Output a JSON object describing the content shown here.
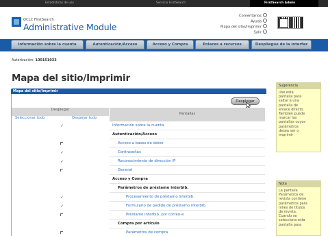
{
  "topbar": {
    "tab1": "Estadísticas de uso",
    "tab2": "Servicio FirstSearch",
    "tab3": "FirstSearch Admin"
  },
  "header": {
    "org": "OCLC FirstSearch",
    "module": "Administrative Module",
    "links": [
      "Comentarios",
      "Ayuda",
      "Mapa del sitio/Imprimir",
      "Salir"
    ]
  },
  "main_tabs": [
    "Información sobre la cuenta",
    "Autenticación/Acceso",
    "Acceso y Compra",
    "Enlaces a recursos",
    "Despliegue de la interfaz"
  ],
  "auth": {
    "label": "Autorización:",
    "value": "100151033"
  },
  "page_title": "Mapa del sitio/Imprimir",
  "panel": {
    "header": "Mapa del sitio/Imprimir",
    "button_label": "Desplegar",
    "col_desplegar": "Desplegar",
    "col_pantallas": "Pantallas",
    "select_all": "Seleccionar todo",
    "deselect_all": "Despejar todo"
  },
  "rows": [
    {
      "label": "Información sobre la cuenta",
      "style": "link",
      "indent": 0,
      "checkbox": "checked"
    },
    {
      "label": "Autenticación/Acceso",
      "style": "bold",
      "indent": 0,
      "checkbox": "none"
    },
    {
      "label": "Acceso a bases de datos",
      "style": "link",
      "indent": 1,
      "checkbox": "unchecked"
    },
    {
      "label": "Contraseñas",
      "style": "link",
      "indent": 1,
      "checkbox": "checked"
    },
    {
      "label": "Reconocimiento de dirección IP",
      "style": "link",
      "indent": 1,
      "checkbox": "checked"
    },
    {
      "label": "General",
      "style": "link",
      "indent": 1,
      "checkbox": "unchecked"
    },
    {
      "label": "Acceso y Compra",
      "style": "bold",
      "indent": 0,
      "checkbox": "none"
    },
    {
      "label": "Parámetros de préstamo interbib.",
      "style": "bold",
      "indent": 1,
      "checkbox": "none"
    },
    {
      "label": "Procesamiento de préstamo interbib.",
      "style": "link",
      "indent": 2,
      "checkbox": "checked"
    },
    {
      "label": "Formulario de pedido de préstamo interbib.",
      "style": "link",
      "indent": 2,
      "checkbox": "checked"
    },
    {
      "label": "Préstamo interbib. por correo-e",
      "style": "link",
      "indent": 2,
      "checkbox": "unchecked"
    },
    {
      "label": "Compra por artículo",
      "style": "bold",
      "indent": 1,
      "checkbox": "none"
    },
    {
      "label": "Parámetros de compra",
      "style": "link",
      "indent": 2,
      "checkbox": "unchecked"
    }
  ],
  "help_boxes": [
    {
      "title": "Sugerencia",
      "body": "Use esta\npantalla para\nsaltar a una\npantalla de\nenlace directo.\nTambién puede\nmarcar las\npantallas cuyos\nparámetros\ndesea ver o\nimprimir"
    },
    {
      "title": "Nota",
      "body": "La pantalla\nParámetros de\nrevista contiene\nparámetros para\nmiles de títulos\nde revista.\nCuando se\nselecciona esta\npantalla para"
    }
  ],
  "colors": {
    "brand_blue": "#1a5ba8",
    "link": "#2a6fc0",
    "help_bg": "#ffffc6"
  }
}
